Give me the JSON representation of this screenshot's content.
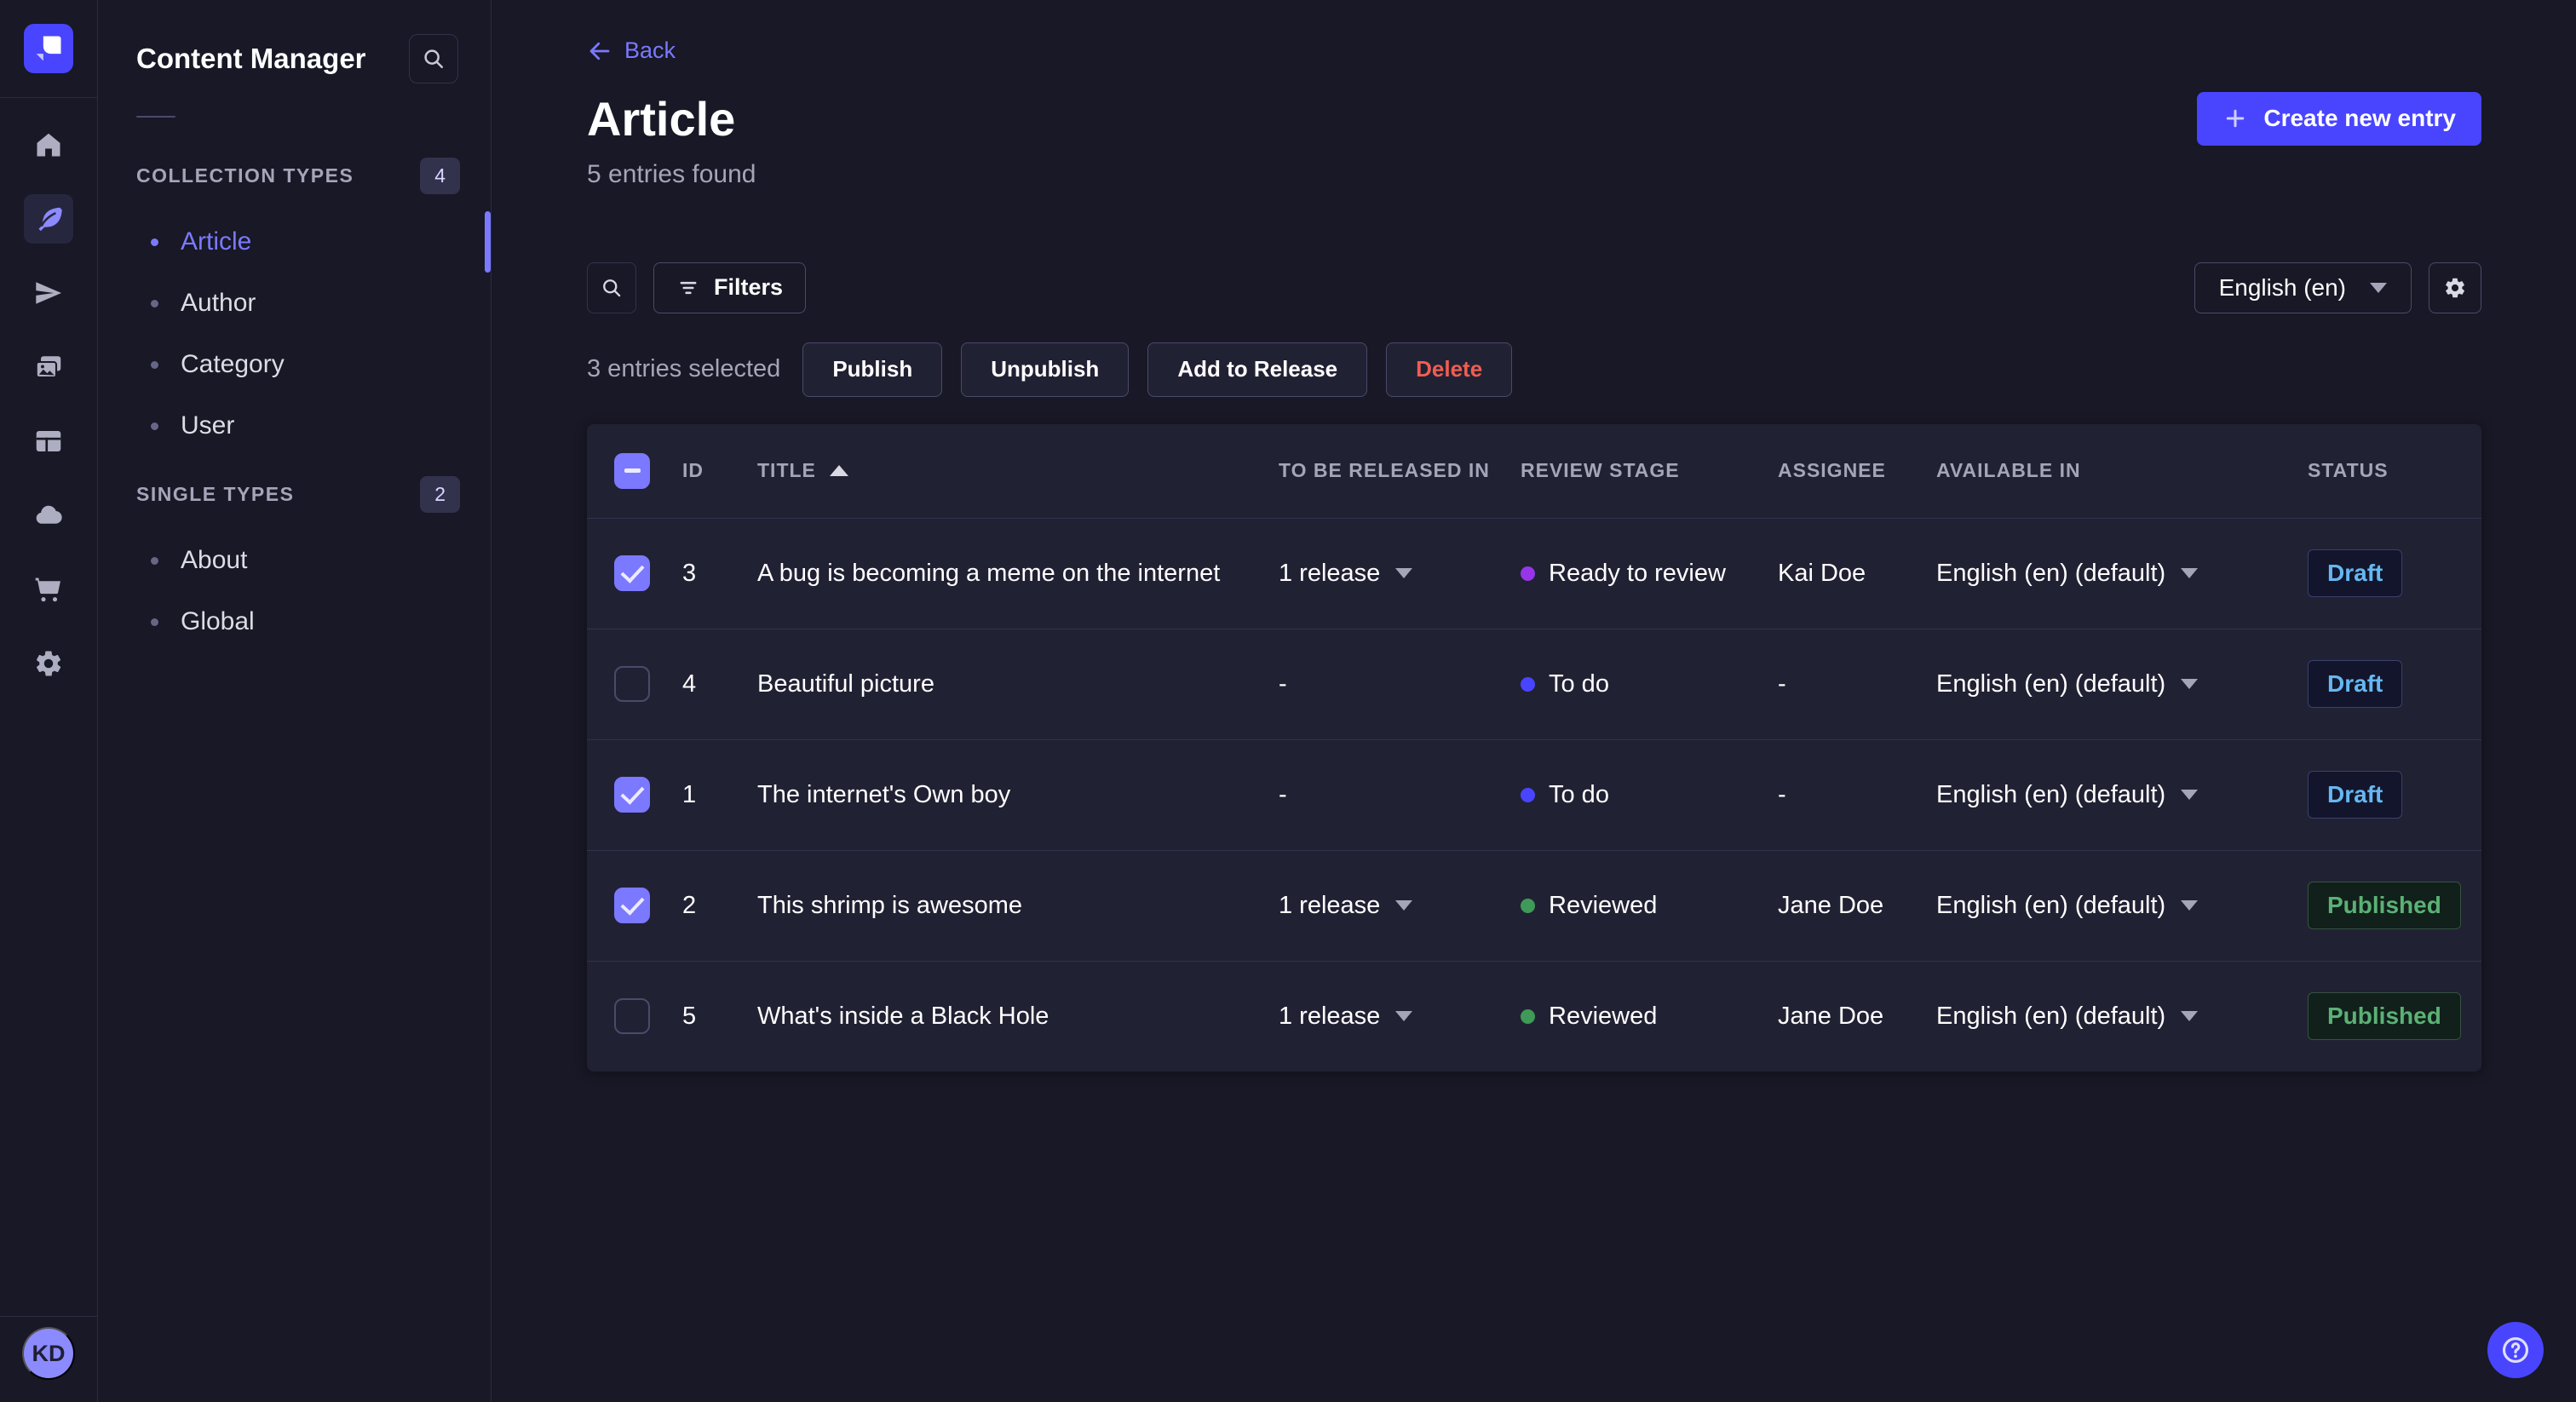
{
  "rail": {
    "icons": [
      {
        "name": "home-icon",
        "active": false
      },
      {
        "name": "content-manager-feather-icon",
        "active": true
      },
      {
        "name": "releases-paper-plane-icon",
        "active": false
      },
      {
        "name": "media-library-images-icon",
        "active": false
      },
      {
        "name": "content-type-builder-layout-icon",
        "active": false
      },
      {
        "name": "deploy-cloud-icon",
        "active": false
      },
      {
        "name": "marketplace-cart-icon",
        "active": false
      },
      {
        "name": "settings-gear-icon",
        "active": false
      }
    ],
    "avatar_initials": "KD"
  },
  "subnav": {
    "title": "Content Manager",
    "sections": [
      {
        "label": "COLLECTION TYPES",
        "count": "4",
        "items": [
          {
            "label": "Article",
            "active": true
          },
          {
            "label": "Author",
            "active": false
          },
          {
            "label": "Category",
            "active": false
          },
          {
            "label": "User",
            "active": false
          }
        ]
      },
      {
        "label": "SINGLE TYPES",
        "count": "2",
        "items": [
          {
            "label": "About",
            "active": false
          },
          {
            "label": "Global",
            "active": false
          }
        ]
      }
    ]
  },
  "header": {
    "back_label": "Back",
    "title": "Article",
    "subtitle": "5 entries found",
    "create_button_label": "Create new entry"
  },
  "toolbar": {
    "filters_label": "Filters",
    "locale_selected": "English (en)"
  },
  "selection": {
    "label": "3 entries selected",
    "actions": [
      {
        "label": "Publish",
        "danger": false
      },
      {
        "label": "Unpublish",
        "danger": false
      },
      {
        "label": "Add to Release",
        "danger": false
      },
      {
        "label": "Delete",
        "danger": true
      }
    ]
  },
  "table": {
    "select_all_state": "indeterminate",
    "headers": [
      {
        "label": "ID"
      },
      {
        "label": "TITLE",
        "sort": "asc"
      },
      {
        "label": "TO BE RELEASED IN"
      },
      {
        "label": "REVIEW STAGE"
      },
      {
        "label": "ASSIGNEE"
      },
      {
        "label": "AVAILABLE IN"
      },
      {
        "label": "STATUS"
      }
    ],
    "rows": [
      {
        "checked": true,
        "id": "3",
        "title": "A bug is becoming a meme on the internet",
        "to_be_released_in": "1 release",
        "release_menu": true,
        "review_stage": {
          "label": "Ready to review",
          "color": "#9736e8"
        },
        "assignee": "Kai Doe",
        "available_in": "English (en) (default)",
        "status": "Draft"
      },
      {
        "checked": false,
        "id": "4",
        "title": "Beautiful picture",
        "to_be_released_in": "-",
        "release_menu": false,
        "review_stage": {
          "label": "To do",
          "color": "#4945ff"
        },
        "assignee": "-",
        "available_in": "English (en) (default)",
        "status": "Draft"
      },
      {
        "checked": true,
        "id": "1",
        "title": "The internet's Own boy",
        "to_be_released_in": "-",
        "release_menu": false,
        "review_stage": {
          "label": "To do",
          "color": "#4945ff"
        },
        "assignee": "-",
        "available_in": "English (en) (default)",
        "status": "Draft"
      },
      {
        "checked": true,
        "id": "2",
        "title": "This shrimp is awesome",
        "to_be_released_in": "1 release",
        "release_menu": true,
        "review_stage": {
          "label": "Reviewed",
          "color": "#3f9a57"
        },
        "assignee": "Jane Doe",
        "available_in": "English (en) (default)",
        "status": "Published"
      },
      {
        "checked": false,
        "id": "5",
        "title": "What's inside a Black Hole",
        "to_be_released_in": "1 release",
        "release_menu": true,
        "review_stage": {
          "label": "Reviewed",
          "color": "#3f9a57"
        },
        "assignee": "Jane Doe",
        "available_in": "English (en) (default)",
        "status": "Published"
      }
    ]
  },
  "colors": {
    "accent": "#4945ff",
    "link": "#7b79ff",
    "page_background": "#181826",
    "panel_background": "#212134",
    "draft_text": "#66b7f1",
    "published_text": "#5cb176",
    "danger_text": "#ee5e52",
    "stage_ready_to_review": "#9736e8",
    "stage_to_do": "#4945ff",
    "stage_reviewed": "#3f9a57"
  }
}
